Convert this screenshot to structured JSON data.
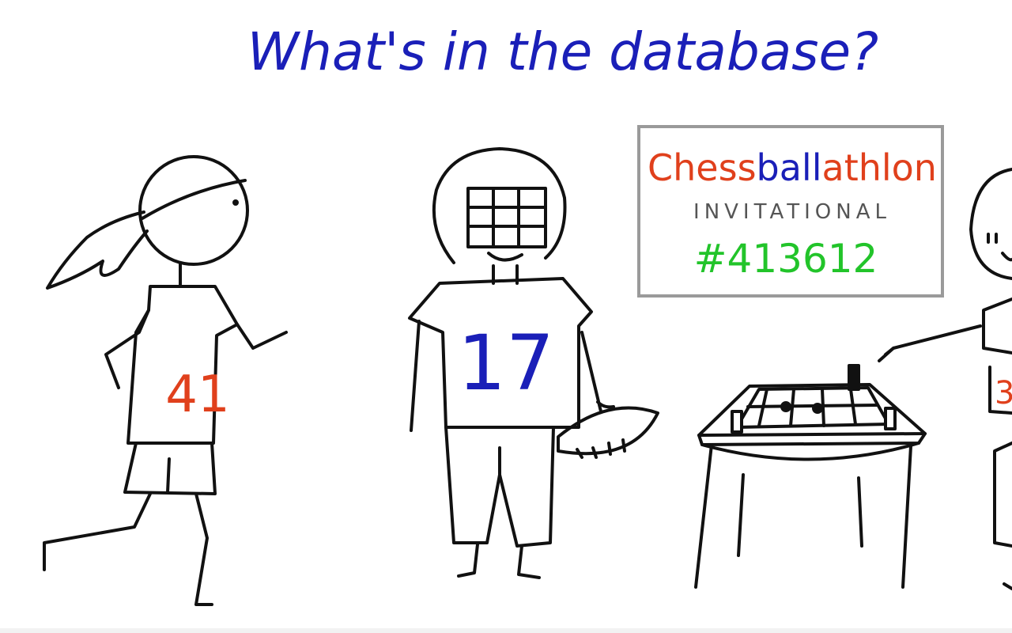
{
  "title": "What's in the database?",
  "sign": {
    "word_parts": [
      "Chess",
      "ball",
      "athlon"
    ],
    "subtitle": "INVITATIONAL",
    "number": "#413612"
  },
  "athletes": {
    "runner_number": "41",
    "football_number": "17",
    "chess_player_number": "3"
  },
  "colors": {
    "title": "#1a1fb8",
    "sign_red": "#e0401c",
    "sign_blue": "#1a1fb8",
    "sign_gray": "#555555",
    "sign_green": "#22c42a",
    "runner_number": "#e0401c",
    "football_number": "#1a1fb8",
    "ink": "#111111"
  }
}
